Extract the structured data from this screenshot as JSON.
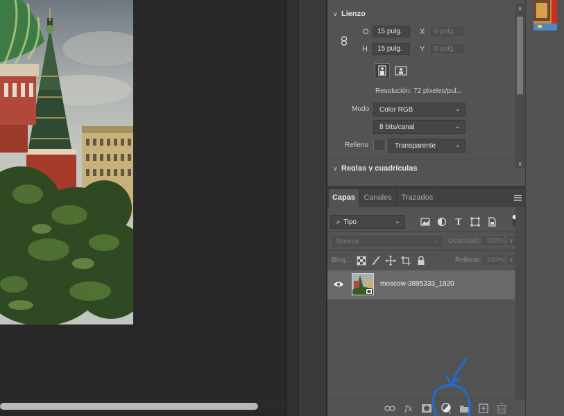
{
  "document": {
    "image_name": "moscow-3895333_1920"
  },
  "properties": {
    "canvas_section": "Lienzo",
    "width_label": "O",
    "width_value": "15 pulg.",
    "height_label": "H",
    "height_value": "15 pulg.",
    "x_label": "X",
    "x_placeholder": "0 pulg.",
    "y_label": "Y",
    "y_placeholder": "0 pulg.",
    "resolution_text": "Resolución:  72 píxeles/pul...",
    "mode_label": "Modo",
    "mode_value": "Color RGB",
    "bits_value": "8 bits/canal",
    "fill_label": "Relleno",
    "fill_value": "Transparente",
    "rulers_section": "Reglas y cuadrículas"
  },
  "layers_panel": {
    "tabs": [
      {
        "label": "Capas"
      },
      {
        "label": "Canales"
      },
      {
        "label": "Trazados"
      }
    ],
    "filter_value": "Tipo",
    "blend_mode": "Normal",
    "opacity_label": "Opacidad:",
    "opacity_value": "100%",
    "lock_label": "Bloq.:",
    "fill_label": "Relleno:",
    "fill_value": "100%",
    "layers": [
      {
        "name": "moscow-3895333_1920"
      }
    ],
    "bottom_icons": [
      "link-icon",
      "fx-icon",
      "mask-icon",
      "adjustment-icon",
      "folder-icon",
      "new-layer-icon",
      "trash-icon"
    ]
  },
  "colors": {
    "panel_bg": "#535353",
    "canvas_bg": "#282828",
    "annotation": "#1a6fd6",
    "layer_selected": "#696969"
  }
}
